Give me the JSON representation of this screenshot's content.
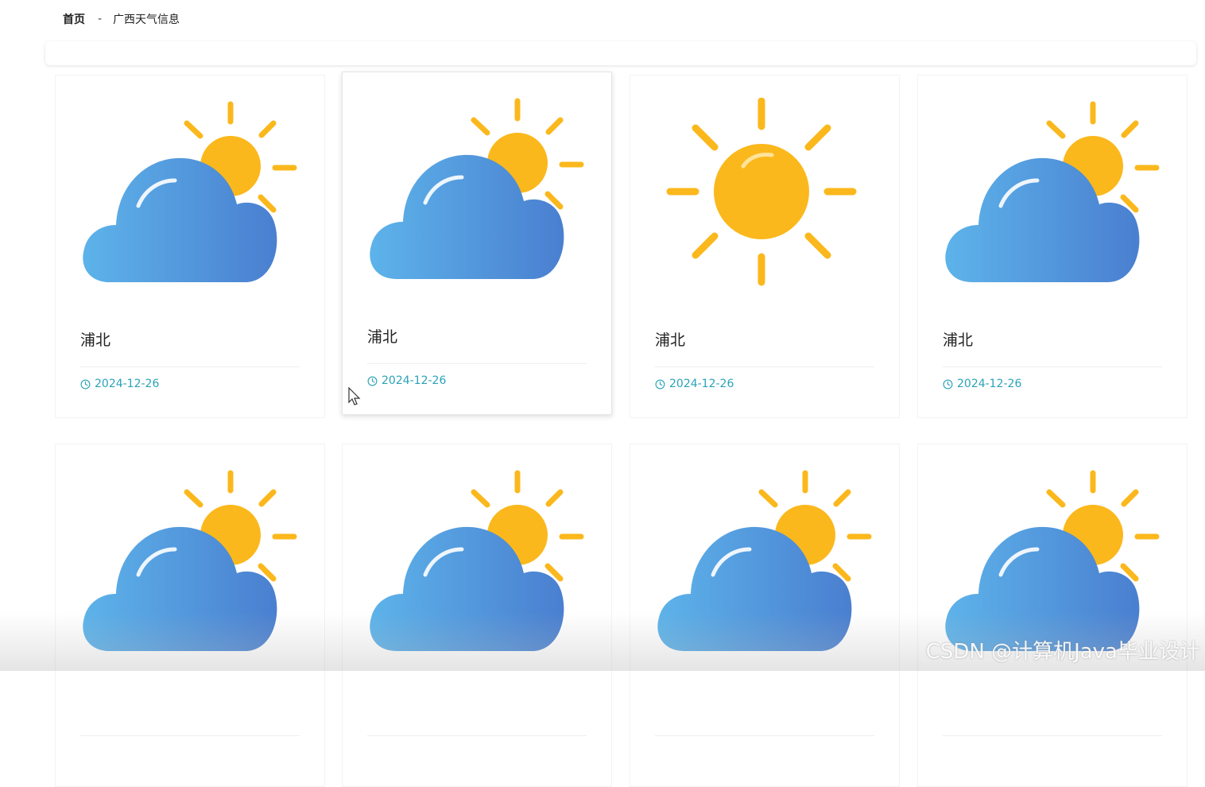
{
  "breadcrumb": {
    "home": "首页",
    "separator": "-",
    "current": "广西天气信息"
  },
  "cards": [
    {
      "city": "浦北",
      "date": "2024-12-26",
      "icon": "partly-cloudy-icon"
    },
    {
      "city": "浦北",
      "date": "2024-12-26",
      "icon": "partly-cloudy-icon"
    },
    {
      "city": "浦北",
      "date": "2024-12-26",
      "icon": "sunny-icon"
    },
    {
      "city": "浦北",
      "date": "2024-12-26",
      "icon": "partly-cloudy-icon"
    },
    {
      "city": "",
      "date": "",
      "icon": "partly-cloudy-icon"
    },
    {
      "city": "",
      "date": "",
      "icon": "partly-cloudy-icon"
    },
    {
      "city": "",
      "date": "",
      "icon": "partly-cloudy-icon"
    },
    {
      "city": "",
      "date": "",
      "icon": "partly-cloudy-icon"
    }
  ],
  "watermark": "CSDN @计算机Java毕业设计",
  "colors": {
    "accent": "#2aa3b8",
    "sun": "#fbb81c",
    "cloud_light": "#5db3ea",
    "cloud_dark": "#4a7fd0"
  }
}
